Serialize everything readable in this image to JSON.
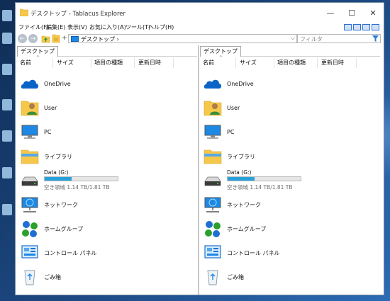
{
  "window": {
    "title": "デスクトップ - Tablacus Explorer",
    "controls": {
      "minimize": "—",
      "maximize": "☐",
      "close": "✕"
    }
  },
  "menu": [
    {
      "label": "ファイル(F)"
    },
    {
      "label": "編集(E)"
    },
    {
      "label": "表示(V)"
    },
    {
      "label": "お気に入り(A)"
    },
    {
      "label": "ツール(T)"
    },
    {
      "label": "ヘルプ(H)"
    }
  ],
  "toolbar": {
    "back": "←",
    "forward": "→",
    "address": "デスクトップ ›",
    "address_dropdown": "⌵",
    "filter_placeholder": "フィルタ"
  },
  "columns": {
    "name": "名前",
    "size": "サイズ",
    "type": "項目の種類",
    "date": "更新日時"
  },
  "panes": [
    {
      "tab": "デスクトップ",
      "items": [
        {
          "label": "OneDrive",
          "icon": "onedrive-icon"
        },
        {
          "label": "User",
          "icon": "user-folder-icon"
        },
        {
          "label": "PC",
          "icon": "pc-icon"
        },
        {
          "label": "ライブラリ",
          "icon": "library-icon"
        },
        {
          "label": "Data (G:)",
          "icon": "drive-icon",
          "free": "空き領域 1.14 TB/1.81 TB",
          "used_fraction": 0.37
        },
        {
          "label": "ネットワーク",
          "icon": "network-icon"
        },
        {
          "label": "ホームグループ",
          "icon": "homegroup-icon"
        },
        {
          "label": "コントロール パネル",
          "icon": "control-panel-icon"
        },
        {
          "label": "ごみ箱",
          "icon": "recycle-bin-icon"
        }
      ]
    },
    {
      "tab": "デスクトップ",
      "items": [
        {
          "label": "OneDrive",
          "icon": "onedrive-icon"
        },
        {
          "label": "User",
          "icon": "user-folder-icon"
        },
        {
          "label": "PC",
          "icon": "pc-icon"
        },
        {
          "label": "ライブラリ",
          "icon": "library-icon"
        },
        {
          "label": "Data (G:)",
          "icon": "drive-icon",
          "free": "空き領域 1.14 TB/1.81 TB",
          "used_fraction": 0.37
        },
        {
          "label": "ネットワーク",
          "icon": "network-icon"
        },
        {
          "label": "ホームグループ",
          "icon": "homegroup-icon"
        },
        {
          "label": "コントロール パネル",
          "icon": "control-panel-icon"
        },
        {
          "label": "ごみ箱",
          "icon": "recycle-bin-icon"
        }
      ]
    }
  ],
  "colors": {
    "accent": "#26a0da",
    "folder": "#f5c84c",
    "onedrive": "#0a64c8"
  }
}
